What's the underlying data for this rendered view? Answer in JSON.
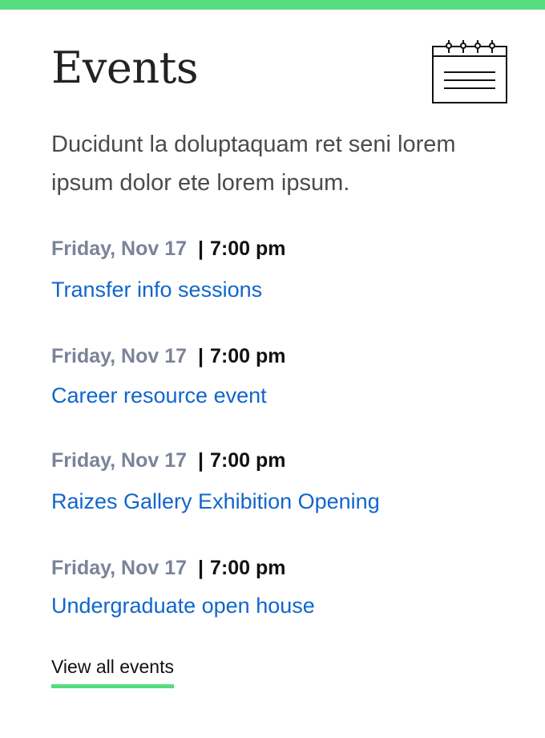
{
  "header": {
    "title": "Events",
    "calendar_icon": "calendar-icon"
  },
  "intro": "Ducidunt la doluptaquam ret seni lorem ipsum dolor ete lorem ipsum.",
  "events": [
    {
      "date": "Friday, Nov 17",
      "separator": "|",
      "time": "7:00 pm",
      "title": "Transfer info sessions"
    },
    {
      "date": "Friday, Nov 17",
      "separator": "|",
      "time": "7:00 pm",
      "title": "Career resource event"
    },
    {
      "date": "Friday, Nov 17",
      "separator": "|",
      "time": "7:00 pm",
      "title": "Raizes Gallery Exhibition Opening"
    },
    {
      "date": "Friday, Nov 17",
      "separator": "|",
      "time": "7:00 pm",
      "title": "Undergraduate open house"
    }
  ],
  "footer": {
    "view_all_label": "View all events"
  },
  "colors": {
    "accent": "#55dd7f",
    "link": "#1166cc",
    "date": "#7a8399"
  }
}
